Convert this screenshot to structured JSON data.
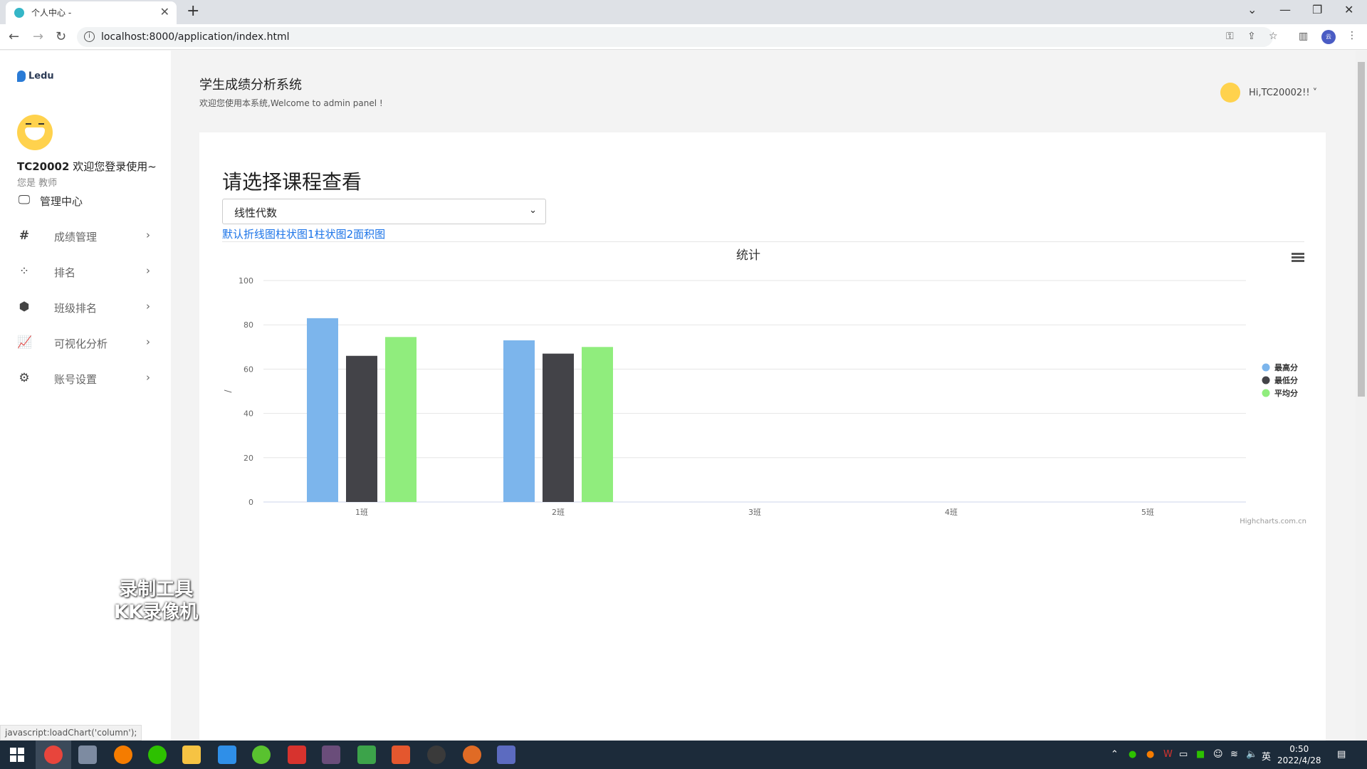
{
  "browser": {
    "tab_title": "个人中心 -",
    "url": "localhost:8000/application/index.html"
  },
  "sidebar": {
    "logo": "Ledu",
    "user_id": "TC20002",
    "welcome": " 欢迎您登录使用~",
    "role": "您是 教师",
    "items": [
      {
        "label": "管理中心",
        "icon": "monitor-icon"
      },
      {
        "label": "成绩管理",
        "icon": "hash-icon"
      },
      {
        "label": "排名",
        "icon": "spinner-icon"
      },
      {
        "label": "班级排名",
        "icon": "cube-icon"
      },
      {
        "label": "可视化分析",
        "icon": "line-chart-icon"
      },
      {
        "label": "账号设置",
        "icon": "gear-icon"
      }
    ]
  },
  "watermark": {
    "line1": "录制工具",
    "line2": "KK录像机"
  },
  "header": {
    "title": "学生成绩分析系统",
    "subtitle": "欢迎您使用本系统,Welcome to admin panel !",
    "user_greeting": "Hi,TC20002!! ˅"
  },
  "main": {
    "title": "请选择课程查看",
    "course_selected": "线性代数",
    "chart_links": [
      "默认折线图",
      "柱状图1",
      "柱状图2",
      "面积图"
    ]
  },
  "chart_data": {
    "type": "bar",
    "title": "统计",
    "ylabel": "/",
    "categories": [
      "1班",
      "2班",
      "3班",
      "4班",
      "5班"
    ],
    "series": [
      {
        "name": "最高分",
        "color": "#7cb5ec",
        "values": [
          83,
          73,
          null,
          null,
          null
        ]
      },
      {
        "name": "最低分",
        "color": "#434348",
        "values": [
          66,
          67,
          null,
          null,
          null
        ]
      },
      {
        "name": "平均分",
        "color": "#90ed7d",
        "values": [
          74.5,
          70,
          null,
          null,
          null
        ]
      }
    ],
    "ylim": [
      0,
      100
    ],
    "yticks": [
      0,
      20,
      40,
      60,
      80,
      100
    ],
    "grid": true,
    "legend": "right",
    "credits": "Highcharts.com.cn"
  },
  "statusbar": "javascript:loadChart('column');",
  "taskbar": {
    "time": "0:50",
    "date": "2022/4/28",
    "ime": "英"
  }
}
